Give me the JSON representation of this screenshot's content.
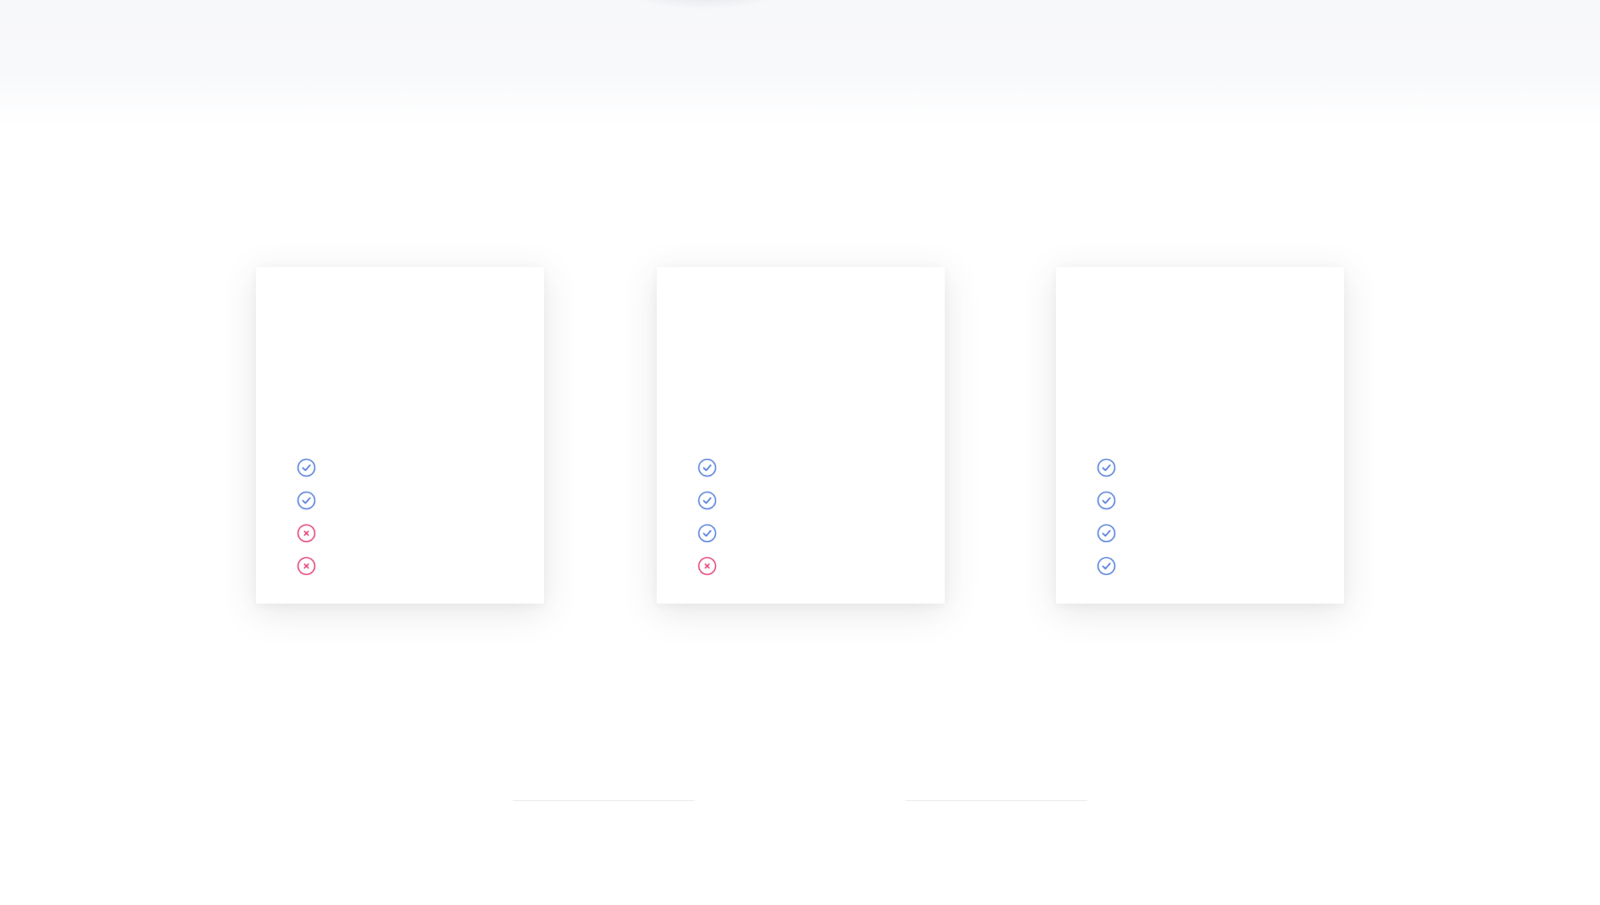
{
  "colors": {
    "check": "#4a76d9",
    "cross": "#e2386e"
  },
  "cards": [
    {
      "features": [
        {
          "status": "included",
          "icon": "check-circle-icon"
        },
        {
          "status": "included",
          "icon": "check-circle-icon"
        },
        {
          "status": "excluded",
          "icon": "x-circle-icon"
        },
        {
          "status": "excluded",
          "icon": "x-circle-icon"
        }
      ]
    },
    {
      "features": [
        {
          "status": "included",
          "icon": "check-circle-icon"
        },
        {
          "status": "included",
          "icon": "check-circle-icon"
        },
        {
          "status": "included",
          "icon": "check-circle-icon"
        },
        {
          "status": "excluded",
          "icon": "x-circle-icon"
        }
      ]
    },
    {
      "features": [
        {
          "status": "included",
          "icon": "check-circle-icon"
        },
        {
          "status": "included",
          "icon": "check-circle-icon"
        },
        {
          "status": "included",
          "icon": "check-circle-icon"
        },
        {
          "status": "included",
          "icon": "check-circle-icon"
        }
      ]
    }
  ]
}
